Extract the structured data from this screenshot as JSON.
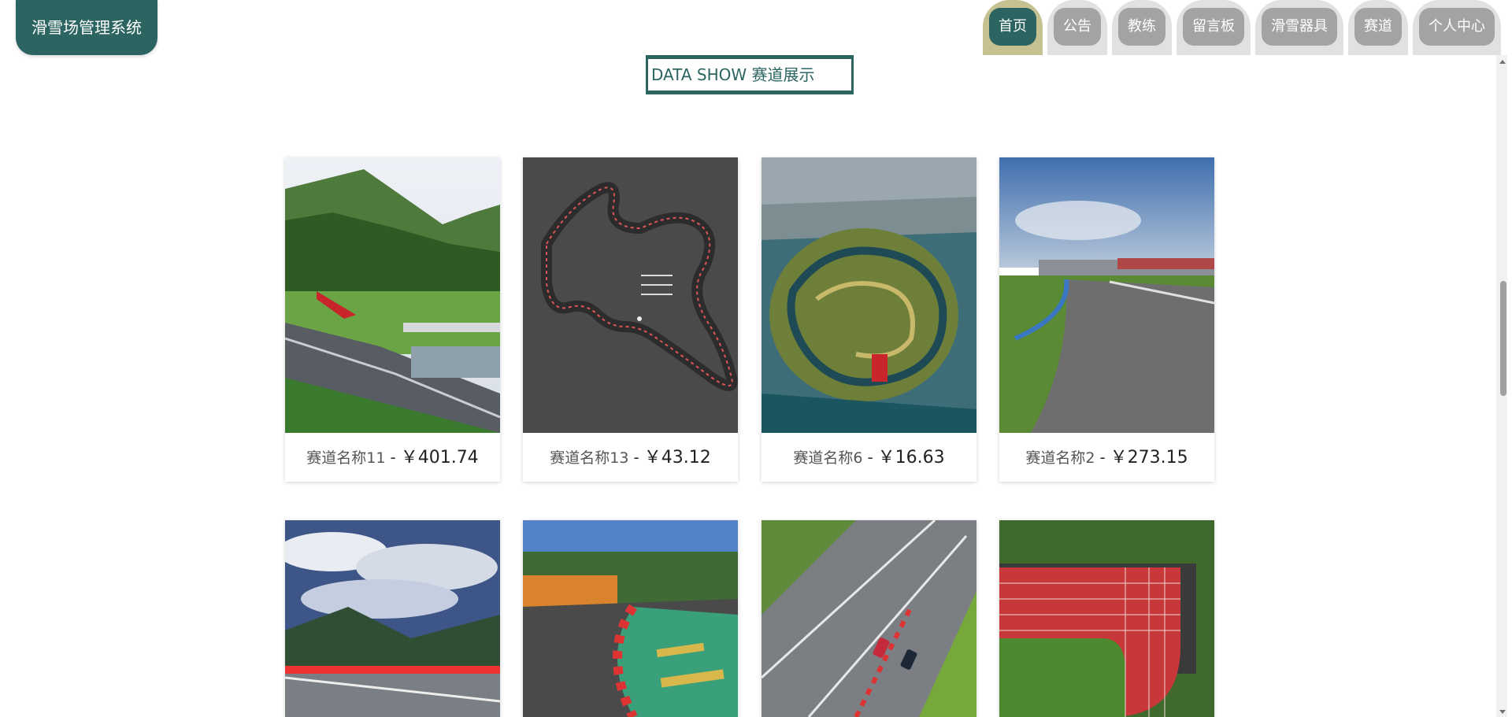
{
  "app": {
    "title": "滑雪场管理系统"
  },
  "nav": {
    "items": [
      {
        "label": "首页",
        "active": true
      },
      {
        "label": "公告",
        "active": false
      },
      {
        "label": "教练",
        "active": false
      },
      {
        "label": "留言板",
        "active": false
      },
      {
        "label": "滑雪器具",
        "active": false
      },
      {
        "label": "赛道",
        "active": false
      },
      {
        "label": "个人中心",
        "active": false
      }
    ]
  },
  "section": {
    "title": "DATA SHOW 赛道展示"
  },
  "cards": [
    {
      "name": "赛道名称11",
      "sep": "-",
      "price": "￥401.74",
      "image": "mountain-race-track-photo"
    },
    {
      "name": "赛道名称13",
      "sep": "-",
      "price": "￥43.12",
      "image": "track-layout-diagram"
    },
    {
      "name": "赛道名称6",
      "sep": "-",
      "price": "￥16.63",
      "image": "aerial-circuit-photo"
    },
    {
      "name": "赛道名称2",
      "sep": "-",
      "price": "￥273.15",
      "image": "empty-asphalt-track-photo"
    },
    {
      "image": "stormy-sky-track-photo"
    },
    {
      "image": "curved-kerb-track-photo"
    },
    {
      "image": "racing-cars-track-photo"
    },
    {
      "image": "running-track-aerial-photo"
    }
  ],
  "colors": {
    "brand": "#2b6461",
    "nav_active_tab": "#c5c190",
    "nav_tab": "#e1e1e1",
    "nav_pill": "#a3a3a3"
  }
}
